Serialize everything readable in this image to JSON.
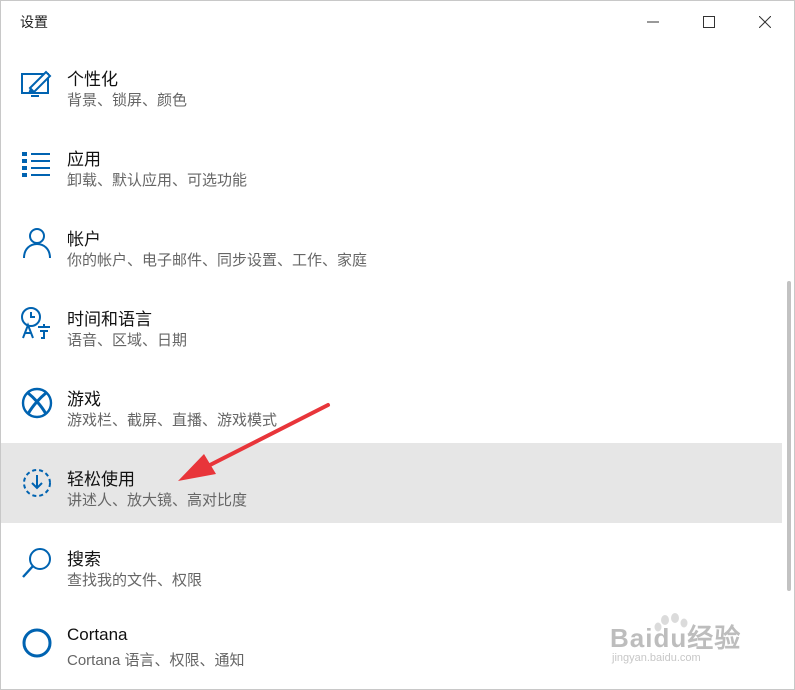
{
  "window": {
    "title": "设置"
  },
  "controls": {
    "minimize": "—",
    "maximize": "☐",
    "close": "✕"
  },
  "items": [
    {
      "label": "个性化",
      "desc": "背景、锁屏、颜色",
      "icon": "personalization-icon"
    },
    {
      "label": "应用",
      "desc": "卸载、默认应用、可选功能",
      "icon": "apps-list-icon"
    },
    {
      "label": "帐户",
      "desc": "你的帐户、电子邮件、同步设置、工作、家庭",
      "icon": "account-person-icon"
    },
    {
      "label": "时间和语言",
      "desc": "语音、区域、日期",
      "icon": "time-language-icon"
    },
    {
      "label": "游戏",
      "desc": "游戏栏、截屏、直播、游戏模式",
      "icon": "xbox-icon"
    },
    {
      "label": "轻松使用",
      "desc": "讲述人、放大镜、高对比度",
      "icon": "ease-of-access-icon",
      "active": true
    },
    {
      "label": "搜索",
      "desc": "查找我的文件、权限",
      "icon": "search-icon"
    },
    {
      "label": "Cortana",
      "desc": "Cortana 语言、权限、通知",
      "icon": "cortana-circle-icon"
    }
  ],
  "watermark": {
    "text": "Baidu经验",
    "sub": "jingyan.baidu.com"
  },
  "colors": {
    "accent": "#0063b1",
    "active_bg": "#e6e6e6",
    "arrow": "#e8353a"
  }
}
